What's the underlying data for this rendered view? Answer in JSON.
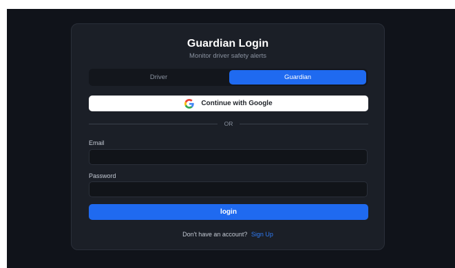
{
  "login": {
    "title": "Guardian Login",
    "subtitle": "Monitor driver safety alerts",
    "roles": {
      "driver": "Driver",
      "guardian": "Guardian",
      "selected": "Guardian"
    },
    "google_button": "Continue with Google",
    "divider": "OR",
    "email": {
      "label": "Email",
      "value": "",
      "placeholder": ""
    },
    "password": {
      "label": "Password",
      "value": "",
      "placeholder": ""
    },
    "login_button": "login",
    "footer": {
      "prompt": "Don't have an account?",
      "signup_link": "Sign Up"
    }
  },
  "colors": {
    "background": "#10131a",
    "card": "#1b1f27",
    "accent": "#1f6af0",
    "link": "#2f7bf5"
  },
  "icons": {
    "google": "google-icon"
  }
}
